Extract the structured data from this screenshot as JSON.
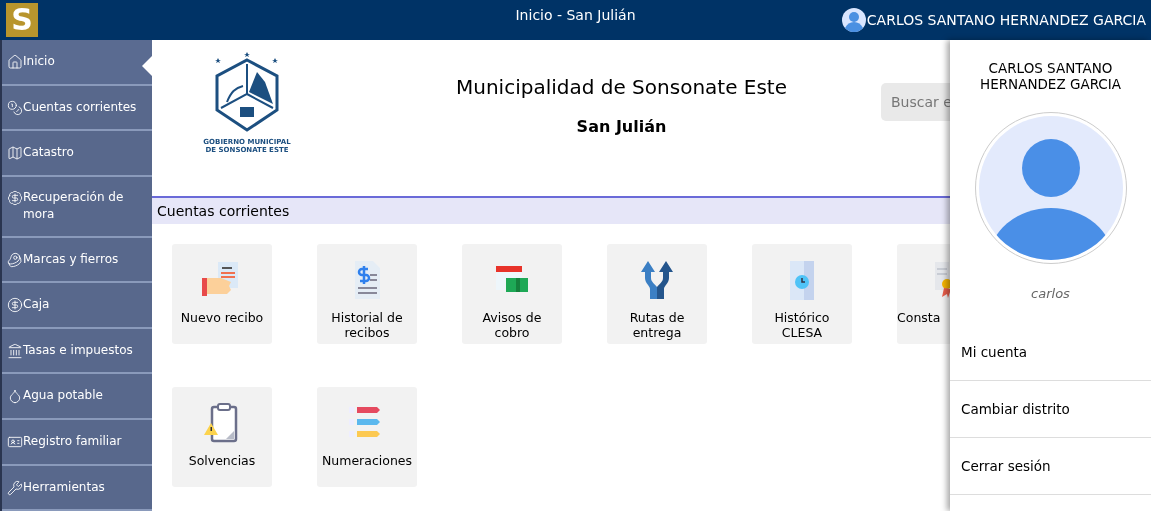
{
  "topbar": {
    "logo": "S",
    "title": "Inicio - San Julián",
    "user": "CARLOS SANTANO HERNANDEZ GARCIA"
  },
  "sidebar": {
    "items": [
      {
        "label": "Inicio",
        "selected": true
      },
      {
        "label": "Cuentas corrientes",
        "selected": false
      },
      {
        "label": "Catastro",
        "selected": false
      },
      {
        "label": "Recuperación de mora",
        "selected": false
      },
      {
        "label": "Marcas y fierros",
        "selected": false
      },
      {
        "label": "Caja",
        "selected": false
      },
      {
        "label": "Tasas e impuestos",
        "selected": false
      },
      {
        "label": "Agua potable",
        "selected": false
      },
      {
        "label": "Registro familiar",
        "selected": false
      },
      {
        "label": "Herramientas",
        "selected": false
      }
    ]
  },
  "header": {
    "emblem_text": "GOBIERNO MUNICIPAL DE SONSONATE ESTE",
    "title": "Municipalidad de Sonsonate Este",
    "subtitle": "San Julián",
    "search": {
      "placeholder": "Buscar e"
    }
  },
  "section": {
    "title": "Cuentas corrientes",
    "cards": [
      {
        "label": "Nuevo recibo"
      },
      {
        "label": "Historial de recibos"
      },
      {
        "label": "Avisos de cobro"
      },
      {
        "label": "Rutas de entrega"
      },
      {
        "label": "Histórico CLESA"
      },
      {
        "label": "Consta"
      },
      {
        "label": "Solvencias"
      },
      {
        "label": "Numeraciones"
      }
    ]
  },
  "user_panel": {
    "name": "CARLOS SANTANO HERNANDEZ GARCIA",
    "username": "carlos",
    "menu": [
      "Mi cuenta",
      "Cambiar distrito",
      "Cerrar sesión"
    ]
  }
}
